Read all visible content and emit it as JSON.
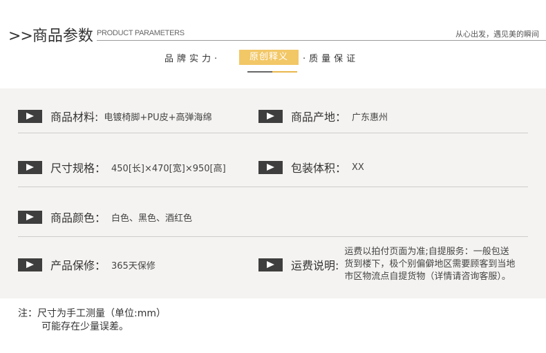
{
  "header": {
    "arrows": ">>",
    "title": "商品参数",
    "subtitle": "PRODUCT PARAMETERS",
    "slogan": "从心出发，遇见美的瞬间"
  },
  "tabs": {
    "left": "品牌实力·",
    "active": "原创释义",
    "right": "·质量保证"
  },
  "colors": {
    "accent": "#f2c766",
    "panel_bg": "#f4f3f1",
    "marker": "#3e3e3e"
  },
  "params": [
    {
      "left": {
        "label": "商品材料:",
        "value": "电镀椅脚+PU皮+高弹海绵"
      },
      "right": {
        "label": "商品产地：",
        "value": "广东惠州"
      }
    },
    {
      "left": {
        "label": "尺寸规格：",
        "value": "450[长]×470[宽]×950[高]"
      },
      "right": {
        "label": "包装体积：",
        "value": "XX"
      }
    },
    {
      "left": {
        "label": "商品颜色：",
        "value": "白色、黑色、酒红色"
      }
    },
    {
      "left": {
        "label": "产品保修：",
        "value": "365天保修"
      },
      "right": {
        "label": "运费说明:",
        "value": "运费以拍付页面为准;自提服务：一般包送货到楼下，极个别偏僻地区需要顾客到当地市区物流点自提货物（详情请咨询客服）。"
      }
    }
  ],
  "note": {
    "line1": "注：尺寸为手工测量（单位:mm）",
    "line2": "可能存在少量误差。"
  }
}
